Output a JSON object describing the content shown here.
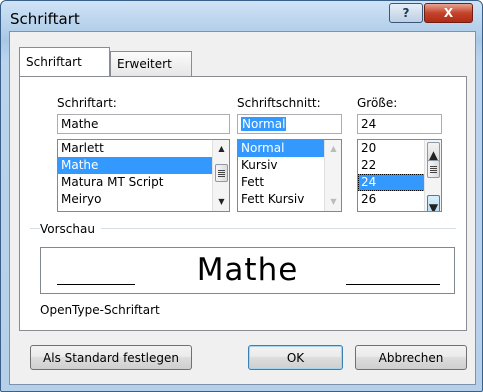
{
  "window": {
    "title": "Schriftart"
  },
  "tabs": [
    {
      "label": "Schriftart",
      "active": true
    },
    {
      "label": "Erweitert",
      "active": false
    }
  ],
  "font": {
    "label": "Schriftart:",
    "value": "Mathe",
    "items": [
      "Marlett",
      "Mathe",
      "Matura MT Script",
      "Meiryo"
    ],
    "selected": "Mathe"
  },
  "style": {
    "label": "Schriftschnitt:",
    "value": "Normal",
    "items": [
      "Normal",
      "Kursiv",
      "Fett",
      "Fett Kursiv"
    ],
    "selected": "Normal"
  },
  "size": {
    "label": "Größe:",
    "value": "24",
    "items": [
      "20",
      "22",
      "24",
      "26"
    ],
    "selected": "24"
  },
  "preview": {
    "label": "Vorschau",
    "sample": "Mathe",
    "font_type": "OpenType-Schriftart"
  },
  "buttons": {
    "set_default": "Als Standard festlegen",
    "ok": "OK",
    "cancel": "Abbrechen"
  },
  "titlebar_buttons": {
    "help": "?",
    "close": "X"
  }
}
